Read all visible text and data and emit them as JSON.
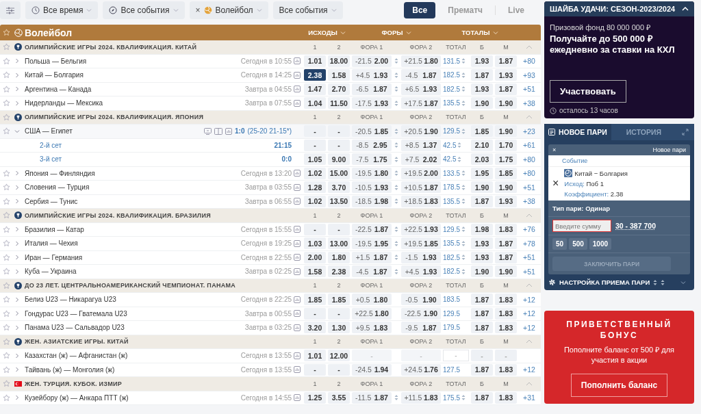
{
  "filters": [
    {
      "kind": "settings"
    },
    {
      "kind": "time",
      "label": "Все время"
    },
    {
      "kind": "status",
      "label": "Все события"
    },
    {
      "kind": "sport",
      "label": "Волейбол",
      "remove": "×"
    },
    {
      "kind": "plain",
      "label": "Все события"
    }
  ],
  "modes": [
    {
      "label": "Все",
      "selected": true
    },
    {
      "label": "Прематч",
      "selected": false
    },
    {
      "label": "Live",
      "selected": false
    }
  ],
  "sport": {
    "name": "Волейбол",
    "groups": [
      "ИСХОДЫ",
      "ФОРЫ",
      "ТОТАЛЫ"
    ]
  },
  "rows": [
    {
      "kind": "league",
      "name": "ОЛИМПИЙСКИЕ ИГРЫ 2024. КВАЛИФИКАЦИЯ. КИТАЙ",
      "columns": [
        "1",
        "2",
        "ФОРА 1",
        "ФОРА 2",
        "ТОТАЛ",
        "Б",
        "М"
      ]
    },
    {
      "kind": "match",
      "name": "Польша — Бельгия",
      "time": "Сегодня в 10:55",
      "expanded": false,
      "outcomes": [
        {
          "odd": "1.01",
          "selected": false
        },
        {
          "odd": "18.00",
          "selected": false
        }
      ],
      "handicap_1": {
        "line": "-21.5",
        "odd": "2.00"
      },
      "handicap_2": {
        "line": "+21.5",
        "odd": "1.80"
      },
      "total": "131.5",
      "over": "1.93",
      "under": "1.87",
      "more": "+80",
      "arrows": true,
      "markets_open": true
    },
    {
      "kind": "match",
      "name": "Китай — Болгария",
      "time": "Сегодня в 14:25",
      "expanded": false,
      "outcomes": [
        {
          "odd": "2.38",
          "selected": true
        },
        {
          "odd": "1.58",
          "selected": false
        }
      ],
      "handicap_1": {
        "line": "+4.5",
        "odd": "1.93"
      },
      "handicap_2": {
        "line": "-4.5",
        "odd": "1.87"
      },
      "total": "182.5",
      "over": "1.87",
      "under": "1.93",
      "more": "+93",
      "arrows": true,
      "markets_open": true
    },
    {
      "kind": "match",
      "name": "Аргентина — Канада",
      "time": "Завтра в 04:55",
      "expanded": false,
      "outcomes": [
        {
          "odd": "1.47",
          "selected": false
        },
        {
          "odd": "2.70",
          "selected": false
        }
      ],
      "handicap_1": {
        "line": "-6.5",
        "odd": "1.87"
      },
      "handicap_2": {
        "line": "+6.5",
        "odd": "1.93"
      },
      "total": "182.5",
      "over": "1.93",
      "under": "1.87",
      "more": "+51",
      "arrows": true,
      "markets_open": true
    },
    {
      "kind": "match",
      "name": "Нидерланды — Мексика",
      "time": "Завтра в 07:55",
      "expanded": false,
      "outcomes": [
        {
          "odd": "1.04",
          "selected": false
        },
        {
          "odd": "11.50",
          "selected": false
        }
      ],
      "handicap_1": {
        "line": "-17.5",
        "odd": "1.93"
      },
      "handicap_2": {
        "line": "+17.5",
        "odd": "1.87"
      },
      "total": "135.5",
      "over": "1.90",
      "under": "1.90",
      "more": "+38",
      "arrows": true,
      "markets_open": true
    },
    {
      "kind": "league",
      "name": "ОЛИМПИЙСКИЕ ИГРЫ 2024. КВАЛИФИКАЦИЯ. ЯПОНИЯ",
      "columns": [
        "1",
        "2",
        "ФОРА 1",
        "ФОРА 2",
        "ТОТАЛ",
        "Б",
        "М"
      ]
    },
    {
      "kind": "match",
      "name": "США — Египет",
      "live": {
        "score": "1:0",
        "sets": "(25-20 21-15*)"
      },
      "expanded": true,
      "outcomes": [
        {
          "odd": "-",
          "selected": false
        },
        {
          "odd": "-",
          "selected": false
        }
      ],
      "handicap_1": {
        "line": "-20.5",
        "odd": "1.85"
      },
      "handicap_2": {
        "line": "+20.5",
        "odd": "1.90"
      },
      "total": "129.5",
      "over": "1.85",
      "under": "1.90",
      "more": "+23",
      "arrows": true,
      "markets_open": true
    },
    {
      "kind": "set",
      "name": "2-й сет",
      "score": "21:15",
      "outcomes": [
        {
          "odd": "-",
          "selected": false
        },
        {
          "odd": "-",
          "selected": false
        }
      ],
      "handicap_1": {
        "line": "-8.5",
        "odd": "2.95"
      },
      "handicap_2": {
        "line": "+8.5",
        "odd": "1.37"
      },
      "total": "42.5",
      "over": "2.10",
      "under": "1.70",
      "more": "+61",
      "arrows": true,
      "markets_open": true
    },
    {
      "kind": "set",
      "name": "3-й сет",
      "score": "0:0",
      "outcomes": [
        {
          "odd": "1.05",
          "selected": false
        },
        {
          "odd": "9.00",
          "selected": false
        }
      ],
      "handicap_1": {
        "line": "-7.5",
        "odd": "1.75"
      },
      "handicap_2": {
        "line": "+7.5",
        "odd": "2.02"
      },
      "total": "42.5",
      "over": "2.03",
      "under": "1.75",
      "more": "+80",
      "arrows": true,
      "markets_open": true
    },
    {
      "kind": "match",
      "name": "Япония — Финляндия",
      "time": "Сегодня в 13:20",
      "expanded": false,
      "outcomes": [
        {
          "odd": "1.02",
          "selected": false
        },
        {
          "odd": "15.00",
          "selected": false
        }
      ],
      "handicap_1": {
        "line": "-19.5",
        "odd": "1.80"
      },
      "handicap_2": {
        "line": "+19.5",
        "odd": "2.00"
      },
      "total": "133.5",
      "over": "1.95",
      "under": "1.85",
      "more": "+80",
      "arrows": true,
      "markets_open": true
    },
    {
      "kind": "match",
      "name": "Словения — Турция",
      "time": "Завтра в 03:55",
      "expanded": false,
      "outcomes": [
        {
          "odd": "1.28",
          "selected": false
        },
        {
          "odd": "3.70",
          "selected": false
        }
      ],
      "handicap_1": {
        "line": "-10.5",
        "odd": "1.93"
      },
      "handicap_2": {
        "line": "+10.5",
        "odd": "1.87"
      },
      "total": "178.5",
      "over": "1.90",
      "under": "1.90",
      "more": "+51",
      "arrows": true,
      "markets_open": true
    },
    {
      "kind": "match",
      "name": "Сербия — Тунис",
      "time": "Завтра в 06:55",
      "expanded": false,
      "outcomes": [
        {
          "odd": "1.02",
          "selected": false
        },
        {
          "odd": "13.50",
          "selected": false
        }
      ],
      "handicap_1": {
        "line": "-18.5",
        "odd": "1.98"
      },
      "handicap_2": {
        "line": "+18.5",
        "odd": "1.83"
      },
      "total": "135.5",
      "over": "1.87",
      "under": "1.93",
      "more": "+38",
      "arrows": true,
      "markets_open": true
    },
    {
      "kind": "league",
      "name": "ОЛИМПИЙСКИЕ ИГРЫ 2024. КВАЛИФИКАЦИЯ. БРАЗИЛИЯ",
      "columns": [
        "1",
        "2",
        "ФОРА 1",
        "ФОРА 2",
        "ТОТАЛ",
        "Б",
        "М"
      ]
    },
    {
      "kind": "match",
      "name": "Бразилия — Катар",
      "time": "Сегодня в 15:55",
      "expanded": false,
      "outcomes": [
        {
          "odd": "-",
          "selected": false
        },
        {
          "odd": "-",
          "selected": false
        }
      ],
      "handicap_1": {
        "line": "-22.5",
        "odd": "1.87"
      },
      "handicap_2": {
        "line": "+22.5",
        "odd": "1.93"
      },
      "total": "129.5",
      "over": "1.98",
      "under": "1.83",
      "more": "+76",
      "arrows": true,
      "markets_open": true
    },
    {
      "kind": "match",
      "name": "Италия — Чехия",
      "time": "Сегодня в 19:25",
      "expanded": false,
      "outcomes": [
        {
          "odd": "1.03",
          "selected": false
        },
        {
          "odd": "13.00",
          "selected": false
        }
      ],
      "handicap_1": {
        "line": "-19.5",
        "odd": "1.95"
      },
      "handicap_2": {
        "line": "+19.5",
        "odd": "1.85"
      },
      "total": "135.5",
      "over": "1.93",
      "under": "1.87",
      "more": "+78",
      "arrows": true,
      "markets_open": true
    },
    {
      "kind": "match",
      "name": "Иран — Германия",
      "time": "Сегодня в 22:55",
      "expanded": false,
      "outcomes": [
        {
          "odd": "2.00",
          "selected": false
        },
        {
          "odd": "1.80",
          "selected": false
        }
      ],
      "handicap_1": {
        "line": "+1.5",
        "odd": "1.87"
      },
      "handicap_2": {
        "line": "-1.5",
        "odd": "1.93"
      },
      "total": "182.5",
      "over": "1.93",
      "under": "1.87",
      "more": "+51",
      "arrows": true,
      "markets_open": true
    },
    {
      "kind": "match",
      "name": "Куба — Украина",
      "time": "Завтра в 02:25",
      "expanded": false,
      "outcomes": [
        {
          "odd": "1.58",
          "selected": false
        },
        {
          "odd": "2.38",
          "selected": false
        }
      ],
      "handicap_1": {
        "line": "-4.5",
        "odd": "1.87"
      },
      "handicap_2": {
        "line": "+4.5",
        "odd": "1.93"
      },
      "total": "182.5",
      "over": "1.90",
      "under": "1.90",
      "more": "+51",
      "arrows": true,
      "markets_open": true
    },
    {
      "kind": "league",
      "name": "ДО 23 ЛЕТ. ЦЕНТРАЛЬНОАМЕРИКАНСКИЙ ЧЕМПИОНАТ. ПАНАМА",
      "columns": [
        "1",
        "2",
        "ФОРА 1",
        "ФОРА 2",
        "ТОТАЛ",
        "Б",
        "М"
      ]
    },
    {
      "kind": "match",
      "name": "Белиз U23 — Никарагуа U23",
      "time": "Сегодня в 22:25",
      "expanded": false,
      "outcomes": [
        {
          "odd": "1.85",
          "selected": false
        },
        {
          "odd": "1.85",
          "selected": false
        }
      ],
      "handicap_1": {
        "line": "+0.5",
        "odd": "1.80"
      },
      "handicap_2": {
        "line": "-0.5",
        "odd": "1.90"
      },
      "total": "183.5",
      "over": "1.87",
      "under": "1.83",
      "more": "+12",
      "arrows": false,
      "markets_open": true
    },
    {
      "kind": "match",
      "name": "Гондурас U23 — Гватемала U23",
      "time": "Завтра в 00:55",
      "expanded": false,
      "outcomes": [
        {
          "odd": "-",
          "selected": false
        },
        {
          "odd": "-",
          "selected": false
        }
      ],
      "handicap_1": {
        "line": "+22.5",
        "odd": "1.80"
      },
      "handicap_2": {
        "line": "-22.5",
        "odd": "1.90"
      },
      "total": "129.5",
      "over": "1.87",
      "under": "1.83",
      "more": "+12",
      "arrows": false,
      "markets_open": true
    },
    {
      "kind": "match",
      "name": "Панама U23 — Сальвадор U23",
      "time": "Завтра в 03:25",
      "expanded": false,
      "outcomes": [
        {
          "odd": "3.20",
          "selected": false
        },
        {
          "odd": "1.30",
          "selected": false
        }
      ],
      "handicap_1": {
        "line": "+9.5",
        "odd": "1.83"
      },
      "handicap_2": {
        "line": "-9.5",
        "odd": "1.87"
      },
      "total": "179.5",
      "over": "1.87",
      "under": "1.83",
      "more": "+12",
      "arrows": false,
      "markets_open": true
    },
    {
      "kind": "league",
      "name": "ЖЕН. АЗИАТСКИЕ ИГРЫ. КИТАЙ",
      "columns": [
        "1",
        "2",
        "ФОРА 1",
        "ФОРА 2",
        "ТОТАЛ",
        "Б",
        "М"
      ]
    },
    {
      "kind": "match",
      "name": "Казахстан (ж) — Афганистан (ж)",
      "time": "Сегодня в 13:55",
      "expanded": false,
      "outcomes": [
        {
          "odd": "1.01",
          "selected": false
        },
        {
          "odd": "12.00",
          "selected": false
        }
      ],
      "handicap_1": "-",
      "handicap_2": "-",
      "total": "-",
      "over": "-",
      "under": "-",
      "arrows": false,
      "markets_open": false
    },
    {
      "kind": "match",
      "name": "Тайвань (ж) — Монголия (ж)",
      "time": "Сегодня в 13:55",
      "expanded": false,
      "outcomes": [
        {
          "odd": "-",
          "selected": false
        },
        {
          "odd": "-",
          "selected": false
        }
      ],
      "handicap_1": {
        "line": "-24.5",
        "odd": "1.94"
      },
      "handicap_2": {
        "line": "+24.5",
        "odd": "1.76"
      },
      "total": "127.5",
      "over": "1.87",
      "under": "1.83",
      "more": "+12",
      "arrows": false,
      "markets_open": true
    },
    {
      "kind": "country-league",
      "name": "ЖЕН. ТУРЦИЯ. КУБОК. ИЗМИР",
      "columns": [
        "1",
        "2",
        "ФОРА 1",
        "ФОРА 2",
        "ТОТАЛ",
        "Б",
        "М"
      ]
    },
    {
      "kind": "match",
      "name": "Кузейбору (ж) — Анкара ПТТ (ж)",
      "time": "Сегодня в 14:55",
      "expanded": false,
      "outcomes": [
        {
          "odd": "1.25",
          "selected": false
        },
        {
          "odd": "3.55",
          "selected": false
        }
      ],
      "handicap_1": {
        "line": "-11.5",
        "odd": "1.87"
      },
      "handicap_2": {
        "line": "+11.5",
        "odd": "1.83"
      },
      "total": "175.5",
      "over": "1.87",
      "under": "1.83",
      "more": "+31",
      "arrows": true,
      "markets_open": true
    }
  ],
  "promo": {
    "title": "ШАЙБА УДАЧИ: СЕЗОН-2023/2024",
    "fund": "Призовой фонд 80 000 000 ₽",
    "headline": "Получайте до 500 000 ₽ ежедневно за ставки на КХЛ",
    "button": "Участвовать",
    "timer": "осталось 13 часов"
  },
  "betslip": {
    "tabs": [
      {
        "label": "НОВОЕ ПАРИ",
        "selected": true
      },
      {
        "label": "ИСТОРИЯ",
        "selected": false
      }
    ],
    "close": "×",
    "heading": "Новое пари",
    "column": "Событие",
    "bet": {
      "remove": "×",
      "event": "Китай − Болгария",
      "outcome_label": "Исход:",
      "outcome": "Поб 1",
      "coef_label": "Коэффициент:",
      "coef": "2.38"
    },
    "type": "Тип пари: Одинар",
    "amount_placeholder": "Введите сумму",
    "range": "30 - 387 700",
    "quick": [
      "50",
      "500",
      "1000"
    ],
    "submit": {
      "label": "ЗАКЛЮЧИТЬ ПАРИ",
      "disabled": true
    },
    "settings": "НАСТРОЙКА ПРИЕМА ПАРИ"
  },
  "bonus": {
    "title": "ПРИВЕТСТВЕННЫЙ БОНУС",
    "text": "Пополните баланс от 500 ₽ для участия в акции",
    "button": "Пополнить баланс"
  }
}
